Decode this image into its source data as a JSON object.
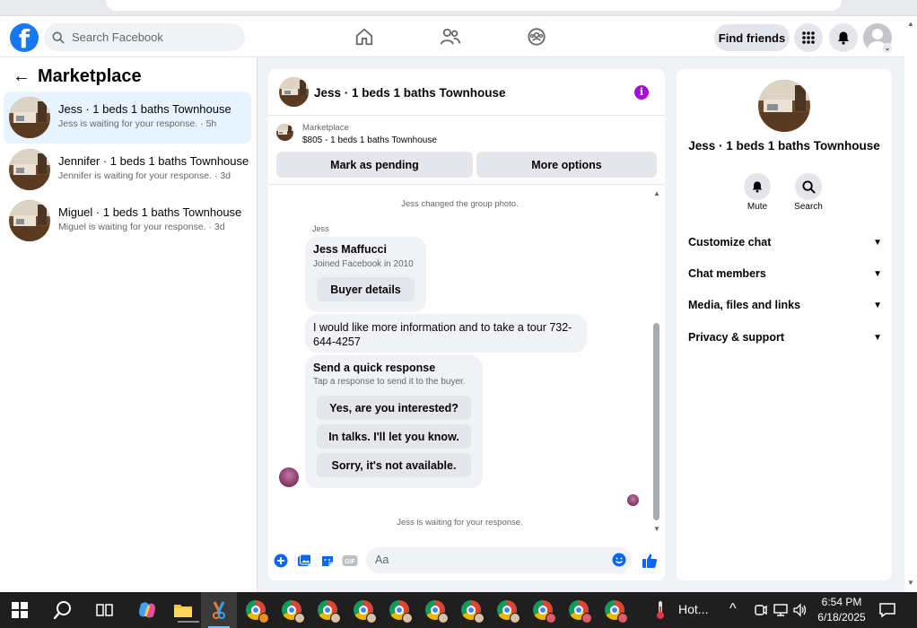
{
  "header": {
    "search_placeholder": "Search Facebook",
    "find_friends": "Find friends"
  },
  "sidebar": {
    "title": "Marketplace",
    "conversations": [
      {
        "title": "Jess · 1 beds 1 baths Townhouse",
        "status": "Jess is waiting for your response. · 5h",
        "active": true
      },
      {
        "title": "Jennifer · 1 beds 1 baths Townhouse",
        "status": "Jennifer is waiting for your response. · 3d",
        "active": false
      },
      {
        "title": "Miguel · 1 beds 1 baths Townhouse",
        "status": "Miguel is waiting for your response. · 3d",
        "active": false
      }
    ]
  },
  "chat": {
    "title": "Jess · 1 beds 1 baths Townhouse",
    "marketplace_label": "Marketplace",
    "listing": "$805 - 1 beds 1 baths Townhouse",
    "mark_pending": "Mark as pending",
    "more_options": "More options",
    "system_group_photo": "Jess changed the group photo.",
    "sender_name": "Jess",
    "profile_card": {
      "name": "Jess Maffucci",
      "joined": "Joined Facebook in 2010",
      "buyer_details": "Buyer details"
    },
    "message": "I would like more information and to take a tour 732-644-4257",
    "quick_response": {
      "title": "Send a quick response",
      "subtitle": "Tap a response to send it to the buyer.",
      "options": [
        "Yes, are you interested?",
        "In talks. I'll let you know.",
        "Sorry, it's not available."
      ]
    },
    "waiting": "Jess is waiting for your response.",
    "composer_placeholder": "Aa"
  },
  "right_panel": {
    "title": "Jess · 1 beds 1 baths Townhouse",
    "mute": "Mute",
    "search": "Search",
    "sections": [
      "Customize chat",
      "Chat members",
      "Media, files and links",
      "Privacy & support"
    ]
  },
  "taskbar": {
    "weather_text": "Hot...",
    "time": "6:54 PM",
    "date": "6/18/2025"
  },
  "colors": {
    "fb_blue": "#1877f2",
    "active_row": "#e7f3ff",
    "info_purple": "#a70dd4",
    "background": "#f0f2f5"
  }
}
